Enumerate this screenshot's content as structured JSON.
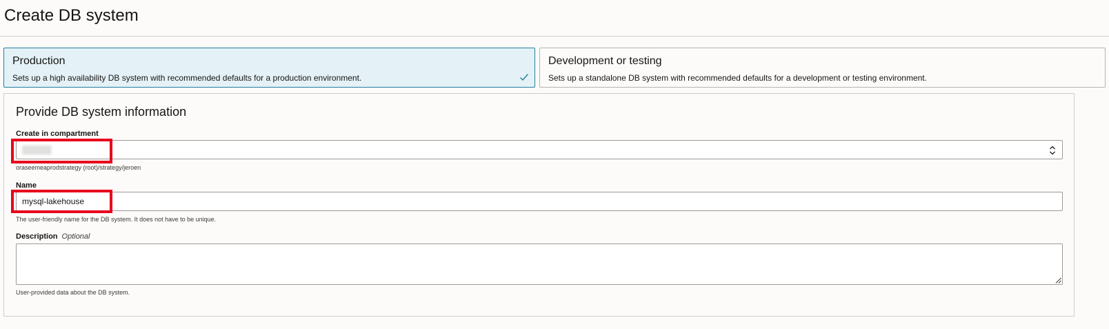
{
  "page": {
    "title": "Create DB system"
  },
  "cards": [
    {
      "title": "Production",
      "description": "Sets up a high availability DB system with recommended defaults for a production environment.",
      "selected": true
    },
    {
      "title": "Development or testing",
      "description": "Sets up a standalone DB system with recommended defaults for a development or testing environment.",
      "selected": false
    }
  ],
  "form": {
    "section_title": "Provide DB system information",
    "compartment": {
      "label": "Create in compartment",
      "value": "",
      "helper": "oraseemeaprodstrategy (root)/strategy/jeroen"
    },
    "name": {
      "label": "Name",
      "value": "mysql-lakehouse",
      "helper": "The user-friendly name for the DB system. It does not have to be unique."
    },
    "description": {
      "label": "Description",
      "optional_label": "Optional",
      "value": "",
      "helper": "User-provided data about the DB system."
    }
  },
  "icons": {
    "selected_check": "check-icon",
    "select_toggle": "chevron-up-down-icon",
    "textarea_resize": "resize-handle-icon"
  },
  "colors": {
    "selected_card_bg": "#e4f1f7",
    "selected_card_border": "#227e9e",
    "highlight": "#e8001c"
  }
}
